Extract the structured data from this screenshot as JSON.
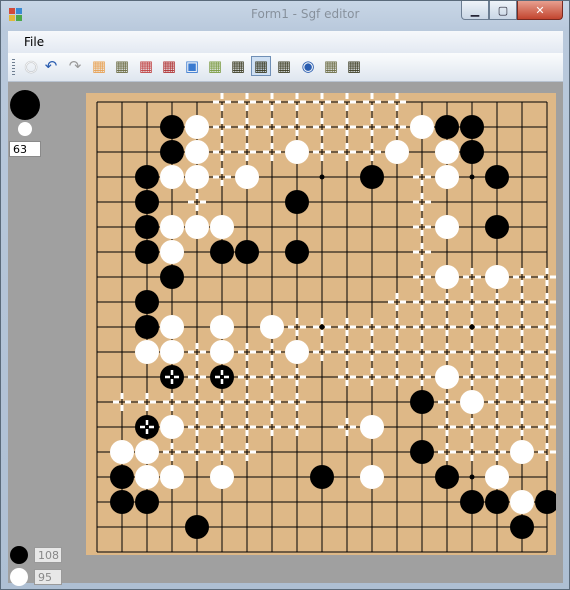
{
  "window": {
    "title": "Form1 - Sgf editor",
    "buttons": {
      "minimize": "▁",
      "maximize": "▢",
      "close": "✕"
    }
  },
  "menu": {
    "file_label": "File"
  },
  "toolbar": {
    "tools": [
      {
        "name": "place-stone-tool",
        "glyph": "○"
      },
      {
        "name": "undo-tool",
        "glyph": "↶"
      },
      {
        "name": "redo-tool",
        "glyph": "↷"
      },
      {
        "name": "grid-tool-1",
        "glyph": "▦"
      },
      {
        "name": "grid-tool-2",
        "glyph": "▦"
      },
      {
        "name": "grid-tool-3",
        "glyph": "▦"
      },
      {
        "name": "grid-tool-4",
        "glyph": "▦"
      },
      {
        "name": "image-tool",
        "glyph": "▣"
      },
      {
        "name": "grid-tool-5",
        "glyph": "▦"
      },
      {
        "name": "grid-tool-6",
        "glyph": "▦"
      },
      {
        "name": "grid-tool-7",
        "glyph": "▦"
      },
      {
        "name": "grid-tool-8",
        "glyph": "▦"
      },
      {
        "name": "eye-tool",
        "glyph": "◉"
      },
      {
        "name": "grid-tool-9",
        "glyph": "▦"
      },
      {
        "name": "grid-tool-10",
        "glyph": "▦"
      }
    ]
  },
  "status": {
    "move_number": "63",
    "black_count": "108",
    "white_count": "95"
  },
  "board": {
    "size": 19,
    "colors": {
      "wood": "#deb887",
      "line": "#000000",
      "black": "#000000",
      "white": "#ffffff"
    },
    "black": [
      [
        3,
        1
      ],
      [
        14,
        1
      ],
      [
        15,
        1
      ],
      [
        3,
        2
      ],
      [
        15,
        2
      ],
      [
        2,
        3
      ],
      [
        11,
        3
      ],
      [
        16,
        3
      ],
      [
        2,
        4
      ],
      [
        8,
        4
      ],
      [
        2,
        5
      ],
      [
        16,
        5
      ],
      [
        2,
        6
      ],
      [
        5,
        6
      ],
      [
        6,
        6
      ],
      [
        8,
        6
      ],
      [
        3,
        7
      ],
      [
        2,
        8
      ],
      [
        2,
        9
      ],
      [
        3,
        11
      ],
      [
        5,
        11
      ],
      [
        13,
        12
      ],
      [
        2,
        13
      ],
      [
        13,
        14
      ],
      [
        1,
        15
      ],
      [
        9,
        15
      ],
      [
        14,
        15
      ],
      [
        1,
        16
      ],
      [
        2,
        16
      ],
      [
        15,
        16
      ],
      [
        16,
        16
      ],
      [
        18,
        16
      ],
      [
        4,
        17
      ],
      [
        17,
        17
      ]
    ],
    "white": [
      [
        4,
        1
      ],
      [
        13,
        1
      ],
      [
        4,
        2
      ],
      [
        8,
        2
      ],
      [
        12,
        2
      ],
      [
        14,
        2
      ],
      [
        3,
        3
      ],
      [
        4,
        3
      ],
      [
        6,
        3
      ],
      [
        14,
        3
      ],
      [
        3,
        5
      ],
      [
        4,
        5
      ],
      [
        5,
        5
      ],
      [
        14,
        5
      ],
      [
        3,
        6
      ],
      [
        14,
        7
      ],
      [
        16,
        7
      ],
      [
        3,
        9
      ],
      [
        5,
        9
      ],
      [
        7,
        9
      ],
      [
        2,
        10
      ],
      [
        3,
        10
      ],
      [
        5,
        10
      ],
      [
        8,
        10
      ],
      [
        14,
        11
      ],
      [
        15,
        12
      ],
      [
        3,
        13
      ],
      [
        11,
        13
      ],
      [
        1,
        14
      ],
      [
        2,
        14
      ],
      [
        17,
        14
      ],
      [
        2,
        15
      ],
      [
        3,
        15
      ],
      [
        5,
        15
      ],
      [
        11,
        15
      ],
      [
        16,
        15
      ],
      [
        17,
        16
      ]
    ],
    "marked": [
      [
        3,
        11
      ],
      [
        5,
        11
      ],
      [
        2,
        13
      ]
    ],
    "hoshi": [
      [
        3,
        3
      ],
      [
        9,
        3
      ],
      [
        15,
        3
      ],
      [
        3,
        9
      ],
      [
        9,
        9
      ],
      [
        15,
        9
      ],
      [
        3,
        15
      ],
      [
        9,
        15
      ],
      [
        15,
        15
      ]
    ],
    "territory": [
      [
        5,
        0
      ],
      [
        6,
        0
      ],
      [
        7,
        0
      ],
      [
        8,
        0
      ],
      [
        9,
        0
      ],
      [
        10,
        0
      ],
      [
        11,
        0
      ],
      [
        12,
        0
      ],
      [
        5,
        1
      ],
      [
        6,
        1
      ],
      [
        7,
        1
      ],
      [
        8,
        1
      ],
      [
        9,
        1
      ],
      [
        10,
        1
      ],
      [
        11,
        1
      ],
      [
        12,
        1
      ],
      [
        5,
        2
      ],
      [
        6,
        2
      ],
      [
        7,
        2
      ],
      [
        9,
        2
      ],
      [
        10,
        2
      ],
      [
        11,
        2
      ],
      [
        5,
        3
      ],
      [
        13,
        3
      ],
      [
        4,
        4
      ],
      [
        13,
        4
      ],
      [
        13,
        5
      ],
      [
        13,
        6
      ],
      [
        13,
        7
      ],
      [
        15,
        7
      ],
      [
        17,
        7
      ],
      [
        18,
        7
      ],
      [
        12,
        8
      ],
      [
        13,
        8
      ],
      [
        14,
        8
      ],
      [
        15,
        8
      ],
      [
        16,
        8
      ],
      [
        17,
        8
      ],
      [
        18,
        8
      ],
      [
        8,
        9
      ],
      [
        9,
        9
      ],
      [
        10,
        9
      ],
      [
        11,
        9
      ],
      [
        12,
        9
      ],
      [
        13,
        9
      ],
      [
        14,
        9
      ],
      [
        15,
        9
      ],
      [
        16,
        9
      ],
      [
        17,
        9
      ],
      [
        18,
        9
      ],
      [
        4,
        10
      ],
      [
        6,
        10
      ],
      [
        7,
        10
      ],
      [
        9,
        10
      ],
      [
        10,
        10
      ],
      [
        11,
        10
      ],
      [
        12,
        10
      ],
      [
        13,
        10
      ],
      [
        14,
        10
      ],
      [
        15,
        10
      ],
      [
        16,
        10
      ],
      [
        17,
        10
      ],
      [
        18,
        10
      ],
      [
        4,
        11
      ],
      [
        6,
        11
      ],
      [
        7,
        11
      ],
      [
        8,
        11
      ],
      [
        10,
        11
      ],
      [
        11,
        11
      ],
      [
        12,
        11
      ],
      [
        13,
        11
      ],
      [
        15,
        11
      ],
      [
        16,
        11
      ],
      [
        17,
        11
      ],
      [
        18,
        11
      ],
      [
        1,
        12
      ],
      [
        2,
        12
      ],
      [
        3,
        12
      ],
      [
        4,
        12
      ],
      [
        5,
        12
      ],
      [
        6,
        12
      ],
      [
        7,
        12
      ],
      [
        8,
        12
      ],
      [
        14,
        12
      ],
      [
        16,
        12
      ],
      [
        17,
        12
      ],
      [
        18,
        12
      ],
      [
        4,
        13
      ],
      [
        5,
        13
      ],
      [
        6,
        13
      ],
      [
        7,
        13
      ],
      [
        8,
        13
      ],
      [
        10,
        13
      ],
      [
        14,
        13
      ],
      [
        15,
        13
      ],
      [
        16,
        13
      ],
      [
        17,
        13
      ],
      [
        18,
        13
      ],
      [
        3,
        14
      ],
      [
        4,
        14
      ],
      [
        5,
        14
      ],
      [
        6,
        14
      ],
      [
        14,
        14
      ],
      [
        15,
        14
      ],
      [
        16,
        14
      ],
      [
        18,
        14
      ]
    ]
  }
}
